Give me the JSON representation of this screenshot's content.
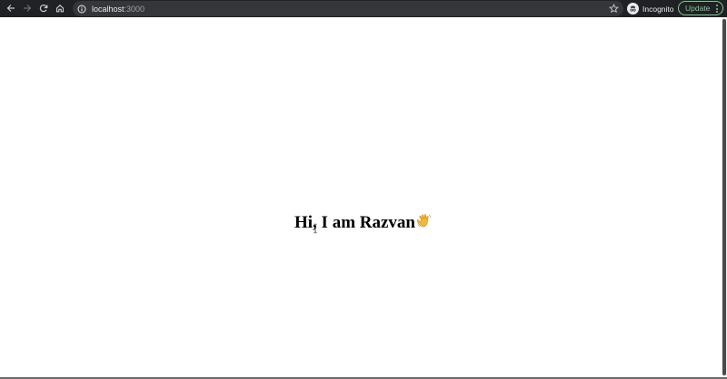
{
  "browser": {
    "address": {
      "host": "localhost",
      "port": ":3000"
    },
    "profile_label": "Incognito",
    "update_label": "Update",
    "icons": {
      "back": "back-arrow-icon",
      "forward": "forward-arrow-icon",
      "reload": "reload-icon",
      "home": "home-icon",
      "site_info": "info-icon",
      "bookmark": "star-icon",
      "incognito": "incognito-icon",
      "menu": "kebab-menu-icon"
    },
    "colors": {
      "toolbar": "#202124",
      "omnibox": "#35363a",
      "update_accent": "#81c995"
    }
  },
  "page": {
    "greeting": "Hi, I am Razvan",
    "emoji": "👋"
  }
}
